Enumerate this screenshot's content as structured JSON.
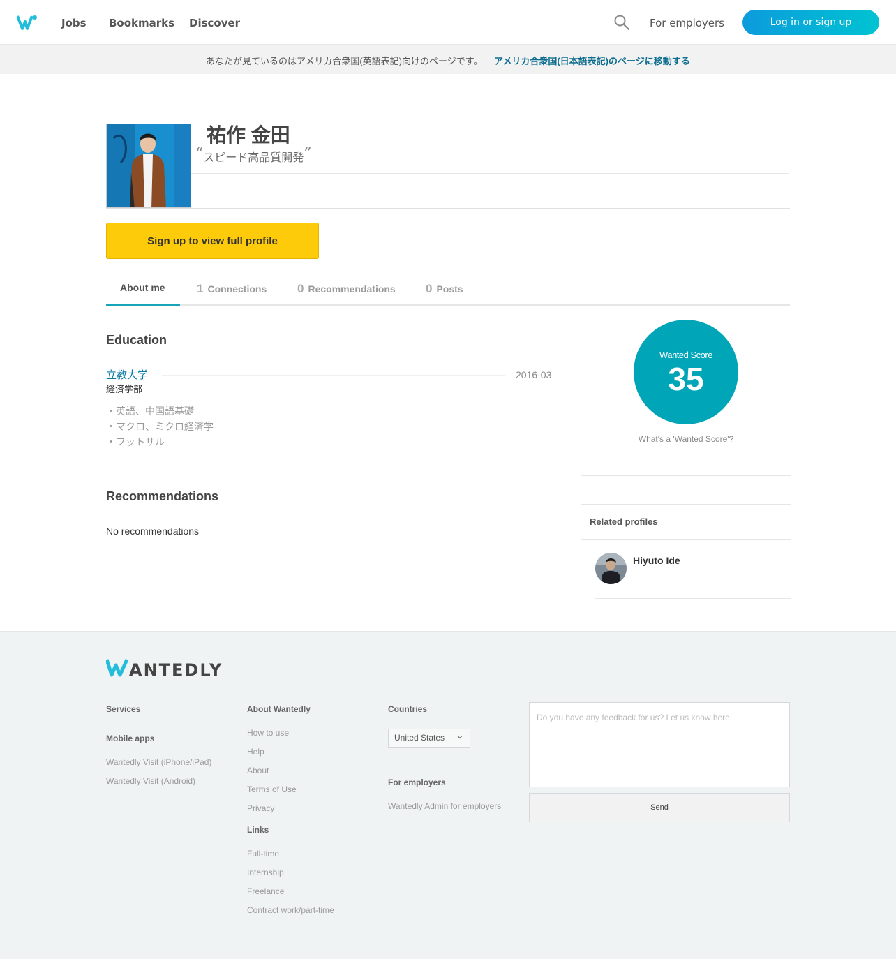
{
  "header": {
    "nav": [
      "Jobs",
      "Bookmarks",
      "Discover"
    ],
    "for_employers": "For employers",
    "login_label": "Log in or sign up"
  },
  "banner": {
    "message": "あなたが見ているのはアメリカ合衆国(英語表記)向けのページです。",
    "link": "アメリカ合衆国(日本語表記)のページに移動する"
  },
  "profile": {
    "name": "祐作 金田",
    "tagline": "スピード高品質開発",
    "signup_label": "Sign up to view full profile"
  },
  "tabs": [
    {
      "num": "",
      "label": "About me"
    },
    {
      "num": "1",
      "label": "Connections"
    },
    {
      "num": "0",
      "label": "Recommendations"
    },
    {
      "num": "0",
      "label": "Posts"
    }
  ],
  "education": {
    "title": "Education",
    "school": "立教大学",
    "date": "2016-03",
    "department": "経済学部",
    "details": [
      "・英語、中国語基礎",
      "・マクロ、ミクロ経済学",
      "・フットサル"
    ]
  },
  "recommendations": {
    "title": "Recommendations",
    "empty": "No recommendations"
  },
  "score": {
    "label": "Wanted Score",
    "value": "35",
    "help": "What's a 'Wanted Score'?"
  },
  "related": {
    "title": "Related profiles",
    "people": [
      {
        "name": "Hiyuto Ide"
      }
    ]
  },
  "footer": {
    "services": "Services",
    "mobile_apps": "Mobile apps",
    "apps": [
      "Wantedly Visit (iPhone/iPad)",
      "Wantedly Visit (Android)"
    ],
    "about_title": "About Wantedly",
    "about_links": [
      "How to use",
      "Help",
      "About",
      "Terms of Use",
      "Privacy"
    ],
    "links_title": "Links",
    "links": [
      "Full-time",
      "Internship",
      "Freelance",
      "Contract work/part-time"
    ],
    "countries_title": "Countries",
    "country": "United States",
    "employers_title": "For employers",
    "employers_link": "Wantedly Admin for employers",
    "feedback_placeholder": "Do you have any feedback for us? Let us know here!",
    "send_label": "Send"
  },
  "colors": {
    "brand": "#21bddb",
    "score": "#00a5b8",
    "cta": "#fdcb0a",
    "link": "#0b7ba3"
  }
}
